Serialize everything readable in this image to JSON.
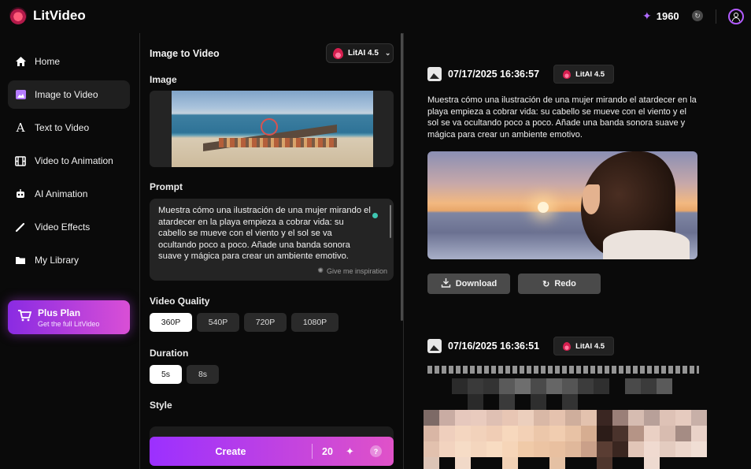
{
  "app": {
    "name": "LitVideo"
  },
  "header": {
    "credits": "1960"
  },
  "sidebar": {
    "items": [
      {
        "label": "Home",
        "icon": "home-icon"
      },
      {
        "label": "Image to Video",
        "icon": "image-icon"
      },
      {
        "label": "Text to Video",
        "icon": "text-icon"
      },
      {
        "label": "Video to Animation",
        "icon": "film-icon"
      },
      {
        "label": "AI Animation",
        "icon": "robot-icon"
      },
      {
        "label": "Video Effects",
        "icon": "wand-icon"
      },
      {
        "label": "My Library",
        "icon": "folder-icon"
      }
    ],
    "active": "Image to Video",
    "plan": {
      "title": "Plus Plan",
      "subtitle": "Get the full LitVideo"
    }
  },
  "form": {
    "title": "Image to Video",
    "model": "LitAI 4.5",
    "image_label": "Image",
    "prompt_label": "Prompt",
    "prompt_text": "Muestra cómo una ilustración de una mujer mirando el atardecer en la playa empieza a cobrar vida: su cabello se mueve con el viento y el sol se va ocultando poco a poco. Añade una banda sonora suave y mágica para crear un ambiente emotivo.",
    "inspiration": "Give me inspiration",
    "quality_label": "Video Quality",
    "quality_options": [
      "360P",
      "540P",
      "720P",
      "1080P"
    ],
    "quality_selected": "360P",
    "duration_label": "Duration",
    "duration_options": [
      "5s",
      "8s"
    ],
    "duration_selected": "5s",
    "style_label": "Style",
    "create": {
      "label": "Create",
      "cost": "20",
      "help": "?"
    }
  },
  "results": [
    {
      "date": "07/17/2025 16:36:57",
      "model": "LitAI 4.5",
      "prompt": "Muestra cómo una ilustración de una mujer mirando el atardecer en la playa empieza a cobrar vida: su cabello se mueve con el viento y el sol se va ocultando poco a poco. Añade una banda sonora suave y mágica para crear un ambiente emotivo.",
      "download_label": "Download",
      "redo_label": "Redo"
    },
    {
      "date": "07/16/2025 16:36:51",
      "model": "LitAI 4.5"
    }
  ],
  "colors": {
    "accent": "#9b30ff",
    "accent2": "#e052c8",
    "background": "#0a0a0a"
  }
}
